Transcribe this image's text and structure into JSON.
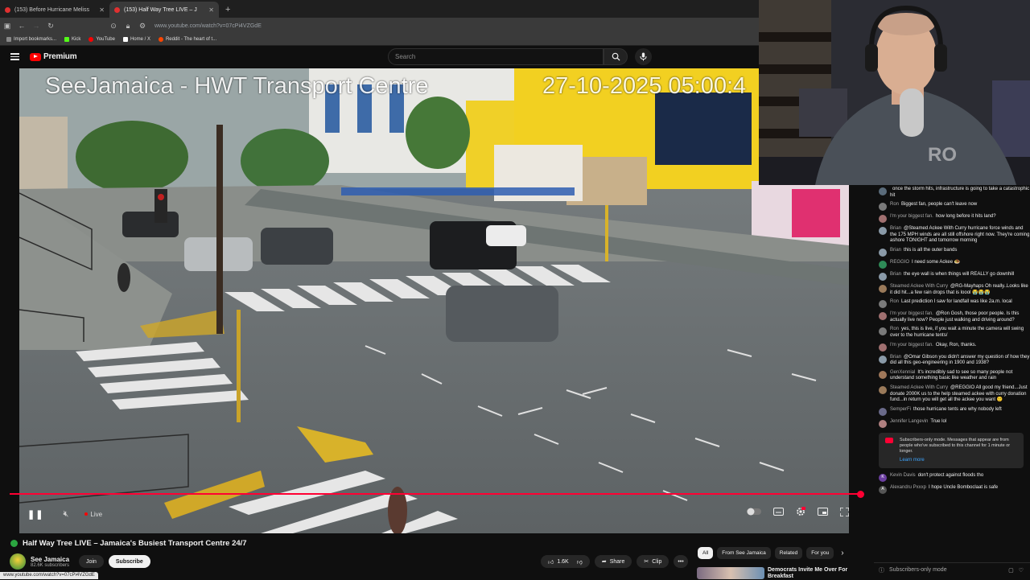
{
  "browser": {
    "tabs": [
      {
        "title": "(153) Before Hurricane Meliss",
        "active": false
      },
      {
        "title": "(153) Half Way Tree LIVE – J",
        "active": true
      }
    ],
    "url": "www.youtube.com/watch?v=07cPi4VZGdE",
    "bookmarks": [
      "Import bookmarks...",
      "Kick",
      "YouTube",
      "Home / X",
      "Reddit - The heart of t..."
    ],
    "status_url": "www.youtube.com/watch?v=07cPi4VZGdE"
  },
  "youtube": {
    "brand": "Premium",
    "search_placeholder": "Search"
  },
  "video": {
    "overlay_title": "SeeJamaica - HWT Transport Centre",
    "overlay_timestamp": "27-10-2025 05:00:4",
    "live_label": "Live",
    "progress_fraction": 1.0
  },
  "info": {
    "title": "Half Way Tree LIVE – Jamaica's Busiest Transport Centre 24/7",
    "channel": "See Jamaica",
    "subscribers": "82.6K subscribers",
    "join_label": "Join",
    "subscribe_label": "Subscribe",
    "likes": "1.6K",
    "share_label": "Share",
    "clip_label": "Clip"
  },
  "chips": [
    "All",
    "From See Jamaica",
    "Related",
    "For you"
  ],
  "recommendation": {
    "title": "Democrats Invite Me Over For Breakfast"
  },
  "chat": {
    "messages": [
      {
        "author": "",
        "text": "once the storm hits, infrastructure is going to take a catastrophic hit",
        "avatar_color": "#5a6b7a"
      },
      {
        "author": "Ron",
        "text": "Biggest fan, people can't leave now",
        "avatar_color": "#7a7a7a"
      },
      {
        "author": "I'm your biggest fan.",
        "text": "how long before it hits land?",
        "avatar_color": "#a07070"
      },
      {
        "author": "Brian",
        "text": "@Steamed Ackee With Curry hurricane force winds and the 175 MPH winds are all still offshore right now. They're coming ashore TONIGHT and tomorrow morning",
        "avatar_color": "#8a9aa8"
      },
      {
        "author": "Brian",
        "text": "this is all the outer bands",
        "avatar_color": "#8a9aa8"
      },
      {
        "author": "REGGIO",
        "text": "I need some Ackee 🧆",
        "avatar_color": "#2e8b57"
      },
      {
        "author": "Brian",
        "text": "the eye wall is when things will REALLY go downhill",
        "avatar_color": "#8a9aa8"
      },
      {
        "author": "Steamed Ackee With Curry",
        "text": "@RG-Mayhaps Oh really..Looks like it did hit...a few rain drops that is loool 😭😭😭",
        "avatar_color": "#9a7a5a"
      },
      {
        "author": "Ron",
        "text": "Last prediction I saw for landfall was like 2a.m. local",
        "avatar_color": "#7a7a7a"
      },
      {
        "author": "I'm your biggest fan.",
        "text": "@Ron Gosh, those poor people. Is this actually live now? People just walking and driving around?",
        "avatar_color": "#a07070"
      },
      {
        "author": "Ron",
        "text": "yes, this is live, if you wait a minute the camera will swing over to the hurricane tents/",
        "avatar_color": "#7a7a7a"
      },
      {
        "author": "I'm your biggest fan.",
        "text": "Okay, Ron, thanks.",
        "avatar_color": "#a07070"
      },
      {
        "author": "Brian",
        "text": "@Omar Gibson you didn't answer my question of how they did all this geo-engineering in 1900 and 1938?",
        "avatar_color": "#8a9aa8"
      },
      {
        "author": "GenXennial",
        "text": "It's incredibly sad to see so many people not understand something basic like weather and rain",
        "avatar_color": "#a0785a"
      },
      {
        "author": "Steamed Ackee With Curry",
        "text": "@REGGIO All good my friend...Just donate 2000K us to the help steamed ackee with curry donation fund...in return you will get all the ackee you want 🙂",
        "avatar_color": "#9a7a5a"
      },
      {
        "author": "SemperFi",
        "text": "those hurricane tents are why nobody left",
        "avatar_color": "#6a6a8a"
      },
      {
        "author": "Jennifer Langevin",
        "text": "True lol",
        "avatar_color": "#b08080"
      }
    ],
    "subscribers_notice": "Subscribers-only mode. Messages that appear are from people who've subscribed to this channel for 1 minute or longer.",
    "learn_more": "Learn more",
    "after_messages": [
      {
        "author": "Kevin Davis",
        "text": "don't protect against floods tho",
        "avatar_color": "#6b3fa0",
        "initial": "K"
      },
      {
        "author": "Alexandru Pxxxp",
        "text": "I hope Uncle Bomboclaat is safe",
        "avatar_color": "#555555",
        "initial": "A"
      }
    ],
    "footer_mode": "Subscribers-only mode"
  }
}
